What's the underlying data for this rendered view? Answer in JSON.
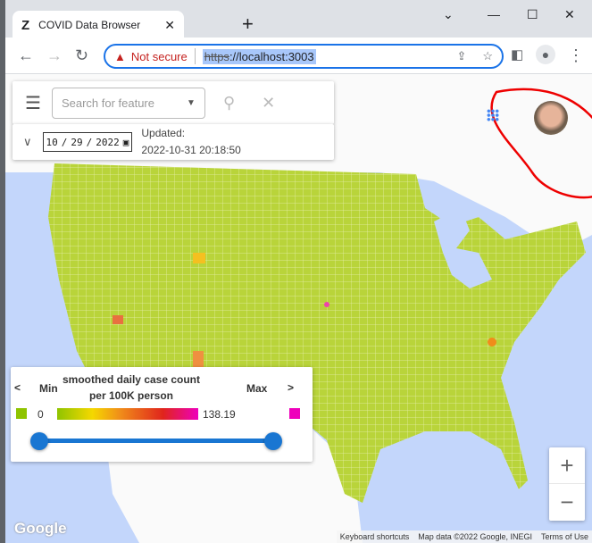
{
  "browser": {
    "tab_title": "COVID Data Browser",
    "url_scheme": "https",
    "url_rest": "://localhost:3003",
    "security": "Not secure"
  },
  "search": {
    "placeholder": "Search for feature"
  },
  "date": {
    "month": "10",
    "day": "29",
    "year": "2022",
    "updated_label": "Updated:",
    "updated_value": "2022-10-31 20:18:50"
  },
  "legend": {
    "prev": "<",
    "next": ">",
    "min_label": "Min",
    "max_label": "Max",
    "title": "smoothed daily case count per 100K person",
    "min_value": "0",
    "max_value": "138.19",
    "min_color": "#8fc400",
    "max_color": "#ee00bb",
    "slider_range": [
      0,
      1
    ]
  },
  "map": {
    "attribution": [
      "Keyboard shortcuts",
      "Map data ©2022 Google, INEGI",
      "Terms of Use"
    ],
    "google": "Google",
    "zoom_in": "+",
    "zoom_out": "−"
  }
}
